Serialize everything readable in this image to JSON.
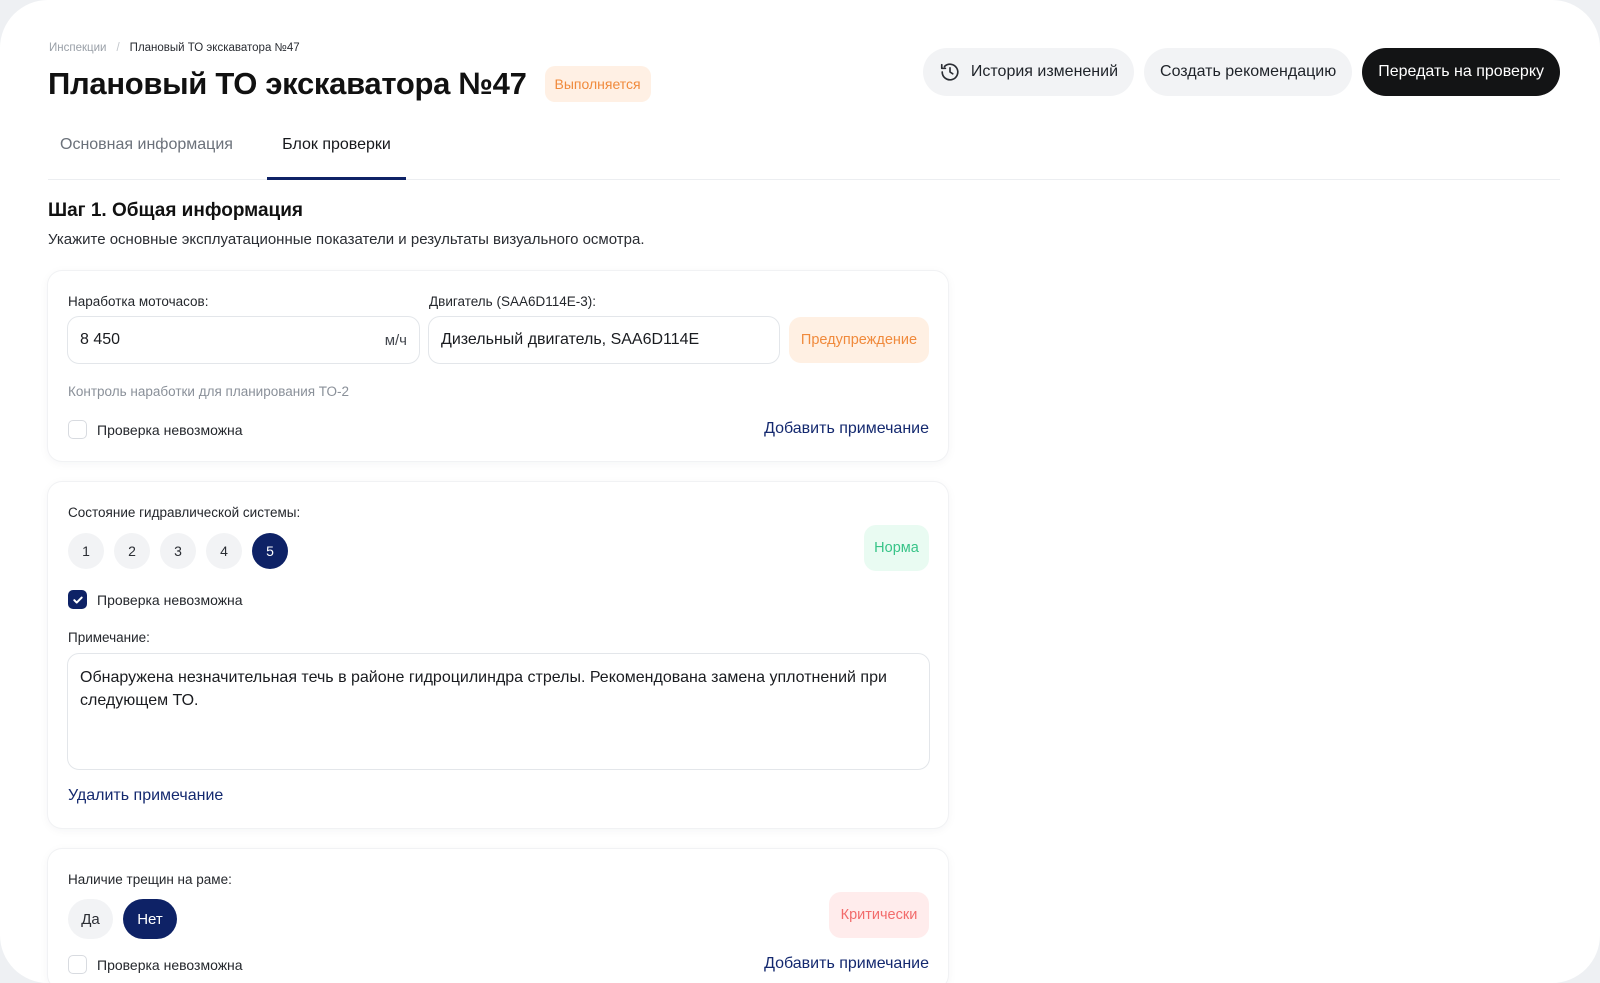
{
  "breadcrumb": {
    "parent": "Инспекции",
    "separator": "/",
    "current": "Плановый ТО экскаватора №47"
  },
  "page": {
    "title": "Плановый ТО экскаватора №47",
    "status": "Выполняется"
  },
  "actions": {
    "history": "История изменений",
    "recommendation": "Создать рекомендацию",
    "submit": "Передать на проверку"
  },
  "tabs": {
    "main": "Основная информация",
    "check": "Блок проверки"
  },
  "section": {
    "title": "Шаг 1. Общая информация",
    "description": "Укажите основные эксплуатационные показатели и результаты визуального осмотра."
  },
  "card1": {
    "hours_label": "Наработка моточасов:",
    "hours_value": "8 450",
    "hours_unit": "м/ч",
    "engine_label": "Двигатель (SAA6D114E-3):",
    "engine_value": "Дизельный двигатель, SAA6D114E",
    "tag": "Предупреждение",
    "hint": "Контроль наработки для планирования ТО-2",
    "check_label": "Проверка невозможна",
    "check_checked": false,
    "add_note": "Добавить примечание"
  },
  "card2": {
    "label": "Состояние гидравлической системы:",
    "ratings": [
      "1",
      "2",
      "3",
      "4",
      "5"
    ],
    "selected_rating": "5",
    "tag": "Норма",
    "check_label": "Проверка невозможна",
    "check_checked": true,
    "note_label": "Примечание:",
    "note_text": "Обнаружена незначительная течь в районе гидроцилиндра стрелы. Рекомендована замена уплотнений при следующем ТО.",
    "remove_note": "Удалить примечание"
  },
  "card3": {
    "label": "Наличие трещин на раме:",
    "yes": "Да",
    "no": "Нет",
    "selected": "Нет",
    "tag": "Критически",
    "check_label": "Проверка невозможна",
    "add_note": "Добавить примечание"
  },
  "colors": {
    "accent": "#0e2266",
    "warning": "#f08a3c",
    "ok": "#38c488",
    "critical": "#f26b6b",
    "dark_button": "#131415"
  }
}
